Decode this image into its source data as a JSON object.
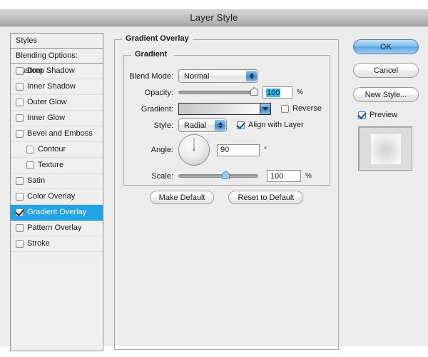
{
  "window": {
    "title": "Layer Style"
  },
  "styles_panel": {
    "header": "Styles",
    "blending_options": "Blending Options: Custom",
    "effects": [
      {
        "label": "Drop Shadow",
        "checked": false,
        "indent": false,
        "selected": false
      },
      {
        "label": "Inner Shadow",
        "checked": false,
        "indent": false,
        "selected": false
      },
      {
        "label": "Outer Glow",
        "checked": false,
        "indent": false,
        "selected": false
      },
      {
        "label": "Inner Glow",
        "checked": false,
        "indent": false,
        "selected": false
      },
      {
        "label": "Bevel and Emboss",
        "checked": false,
        "indent": false,
        "selected": false
      },
      {
        "label": "Contour",
        "checked": false,
        "indent": true,
        "selected": false
      },
      {
        "label": "Texture",
        "checked": false,
        "indent": true,
        "selected": false
      },
      {
        "label": "Satin",
        "checked": false,
        "indent": false,
        "selected": false
      },
      {
        "label": "Color Overlay",
        "checked": false,
        "indent": false,
        "selected": false
      },
      {
        "label": "Gradient Overlay",
        "checked": true,
        "indent": false,
        "selected": true
      },
      {
        "label": "Pattern Overlay",
        "checked": false,
        "indent": false,
        "selected": false
      },
      {
        "label": "Stroke",
        "checked": false,
        "indent": false,
        "selected": false
      }
    ]
  },
  "main": {
    "legend": "Gradient Overlay",
    "gradient_group": {
      "legend": "Gradient",
      "blend_mode": {
        "label": "Blend Mode:",
        "value": "Normal"
      },
      "opacity": {
        "label": "Opacity:",
        "value": "100",
        "unit": "%",
        "percent": 100
      },
      "gradient": {
        "label": "Gradient:",
        "reverse_label": "Reverse",
        "reverse_checked": false
      },
      "style": {
        "label": "Style:",
        "value": "Radial",
        "align_label": "Align with Layer",
        "align_checked": true
      },
      "angle": {
        "label": "Angle:",
        "value": "90",
        "unit": "°",
        "degrees": 90
      },
      "scale": {
        "label": "Scale:",
        "value": "100",
        "unit": "%",
        "percent": 60
      }
    },
    "make_default_label": "Make Default",
    "reset_default_label": "Reset to Default"
  },
  "buttons": {
    "ok": "OK",
    "cancel": "Cancel",
    "new_style": "New Style...",
    "preview_label": "Preview",
    "preview_checked": true
  },
  "colors": {
    "selection_blue": "#22a3e8",
    "text_highlight": "#2ec1f0",
    "accent_blue": "#4f93d4",
    "panel_bg": "#ececec"
  }
}
